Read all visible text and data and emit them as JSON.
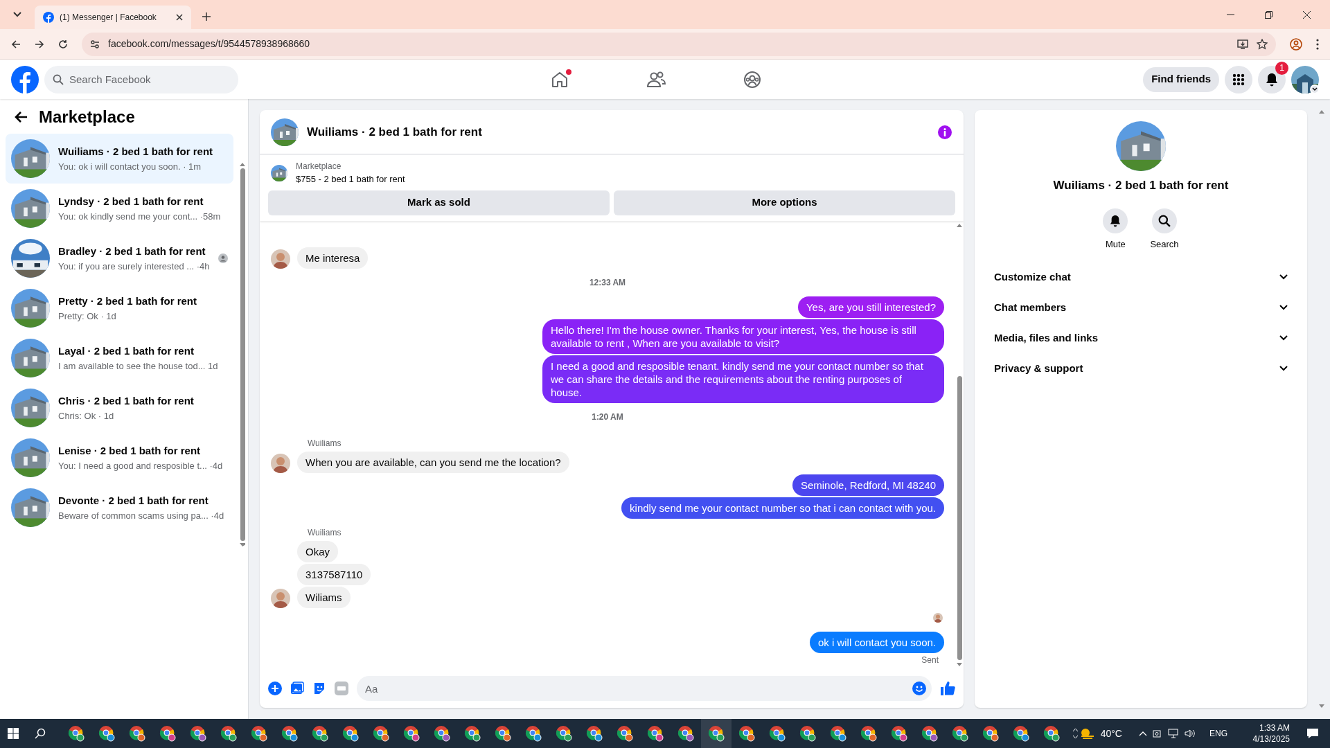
{
  "browser": {
    "tab_title": "(1) Messenger | Facebook",
    "url": "facebook.com/messages/t/9544578938968660"
  },
  "header": {
    "search_placeholder": "Search Facebook",
    "home_dot": true,
    "find_friends": "Find friends",
    "notification_count": "1"
  },
  "sidebar": {
    "title": "Marketplace",
    "conversations": [
      {
        "title": "Wuiliams · 2 bed 1 bath for rent",
        "preview": "You: ok i will contact you soon. · 1m",
        "selected": true,
        "person_icon": false
      },
      {
        "title": "Lyndsy · 2 bed 1 bath for rent",
        "preview": "You: ok kindly send me your cont... ·58m",
        "selected": false,
        "person_icon": false
      },
      {
        "title": "Bradley · 2 bed 1 bath for rent",
        "preview": "You: if you are surely interested ... ·4h",
        "selected": false,
        "person_icon": true
      },
      {
        "title": "Pretty · 2 bed 1 bath for rent",
        "preview": "Pretty: Ok · 1d",
        "selected": false,
        "person_icon": false
      },
      {
        "title": "Layal · 2 bed 1 bath for rent",
        "preview": "I am available to see the house tod... 1d",
        "selected": false,
        "person_icon": false
      },
      {
        "title": "Chris · 2 bed 1 bath for rent",
        "preview": "Chris: Ok · 1d",
        "selected": false,
        "person_icon": false
      },
      {
        "title": "Lenise · 2 bed 1 bath for rent",
        "preview": "You: I need a good and resposible t... ·4d",
        "selected": false,
        "person_icon": false
      },
      {
        "title": "Devonte · 2 bed 1 bath for rent",
        "preview": "Beware of common scams using pa... ·4d",
        "selected": false,
        "person_icon": false
      }
    ]
  },
  "chat": {
    "title": "Wuiliams · 2 bed 1 bath for rent",
    "listing": {
      "label": "Marketplace",
      "name": "$755 - 2 bed 1 bath for rent"
    },
    "buttons": [
      "Mark as sold",
      "More options"
    ],
    "messages": [
      {
        "kind": "incoming",
        "text": "Me interesa",
        "avatar": true
      },
      {
        "kind": "time",
        "text": "12:33 AM"
      },
      {
        "kind": "outgoing",
        "text": "Yes, are you still interested?",
        "color": "#9d1ff2"
      },
      {
        "kind": "outgoing",
        "text": "Hello there! I'm the house owner. Thanks for your interest, Yes, the house is still available to rent , When are you available to visit?",
        "color": "#8a22f6"
      },
      {
        "kind": "outgoing",
        "text": "I need a good and resposible tenant.  kindly send me your contact number so that we can share the details and the requirements about the renting purposes of house.",
        "color": "#7a2cf6"
      },
      {
        "kind": "time",
        "text": "1:20 AM"
      },
      {
        "kind": "sender",
        "text": "Wuiliams"
      },
      {
        "kind": "incoming",
        "text": "When you are available, can you send me the location?",
        "avatar": true
      },
      {
        "kind": "outgoing",
        "text": "Seminole, Redford, MI 48240",
        "color": "#4c46ef"
      },
      {
        "kind": "outgoing",
        "text": "kindly send me your contact number so that i can contact with you.",
        "color": "#4250f1"
      },
      {
        "kind": "sender",
        "text": "Wuiliams"
      },
      {
        "kind": "incoming",
        "text": "Okay",
        "avatar": false
      },
      {
        "kind": "incoming",
        "text": "3137587110",
        "avatar": false
      },
      {
        "kind": "incoming",
        "text": "Wiliams",
        "avatar": true
      },
      {
        "kind": "seen"
      },
      {
        "kind": "outgoing",
        "text": "ok i will contact you soon.",
        "color": "#0a7cff"
      },
      {
        "kind": "status",
        "text": "Sent"
      }
    ],
    "composer_placeholder": "Aa"
  },
  "details": {
    "title": "Wuiliams · 2 bed 1 bath for rent",
    "actions": [
      {
        "kind": "mute",
        "label": "Mute"
      },
      {
        "kind": "search",
        "label": "Search"
      }
    ],
    "sections": [
      {
        "label": "Customize chat",
        "expanded": false
      },
      {
        "label": "Chat members",
        "expanded": false
      },
      {
        "label": "Media, files and links",
        "expanded": false
      },
      {
        "label": "Privacy & support",
        "expanded": false
      }
    ]
  },
  "taskbar": {
    "temperature": "40°C",
    "language": "ENG",
    "time": "1:33 AM",
    "date": "4/13/2025"
  }
}
